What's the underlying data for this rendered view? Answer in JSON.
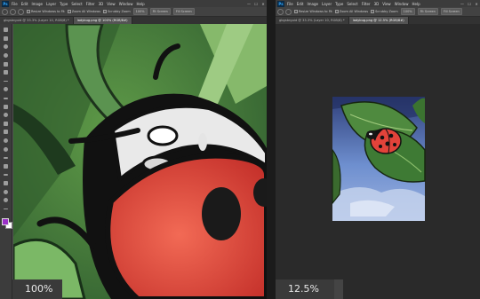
{
  "left_window": {
    "menu": [
      "File",
      "Edit",
      "Image",
      "Layer",
      "Type",
      "Select",
      "Filter",
      "3D",
      "View",
      "Window",
      "Help"
    ],
    "window_controls": [
      "—",
      "☐",
      "✕"
    ],
    "options": {
      "resize_windows": "Resize Windows to Fit",
      "zoom_all": "Zoom All Windows",
      "scrubby_zoom": "Scrubby Zoom",
      "btn_100": "100%",
      "fit_screen": "Fit Screen",
      "fill_screen": "Fill Screen"
    },
    "tabs": [
      {
        "label": "gbgsbrguid @ 33.3% (Layer 10, RGB/8) *"
      },
      {
        "label": "ladybug.png @ 100% (RGB/8#)"
      }
    ],
    "zoom_text": "100%"
  },
  "right_window": {
    "menu": [
      "File",
      "Edit",
      "Image",
      "Layer",
      "Type",
      "Select",
      "Filter",
      "3D",
      "View",
      "Window",
      "Help"
    ],
    "window_controls": [
      "—",
      "☐",
      "✕"
    ],
    "options": {
      "resize_windows": "Resize Windows to Fit",
      "zoom_all": "Zoom All Windows",
      "scrubby_zoom": "Scrubby Zoom",
      "btn_100": "100%",
      "fit_screen": "Fit Screen",
      "fill_screen": "Fill Screen"
    },
    "tabs": [
      {
        "label": "gbgsbrguid @ 33.3% (Layer 10, RGB/8) *"
      },
      {
        "label": "ladybug.png @ 12.5% (RGB/8#)"
      }
    ],
    "zoom_text": "12.5%"
  },
  "colors": {
    "foreground_swatch": "#9b30c8",
    "background_swatch": "#ffffff",
    "ladybug_red": "#e2433a",
    "leaf_green": "#4f8a3f",
    "sky_blue": "#6e8fcf"
  },
  "toolbar_icons": [
    "move-icon",
    "marquee-icon",
    "lasso-icon",
    "quick-select-icon",
    "crop-icon",
    "frame-icon",
    "eyedropper-icon",
    "healing-icon",
    "brush-icon",
    "clone-stamp-icon",
    "history-brush-icon",
    "eraser-icon",
    "gradient-icon",
    "blur-icon",
    "dodge-icon",
    "pen-icon",
    "type-icon",
    "path-select-icon",
    "shape-icon",
    "hand-icon",
    "zoom-icon",
    "more-tools-icon"
  ]
}
